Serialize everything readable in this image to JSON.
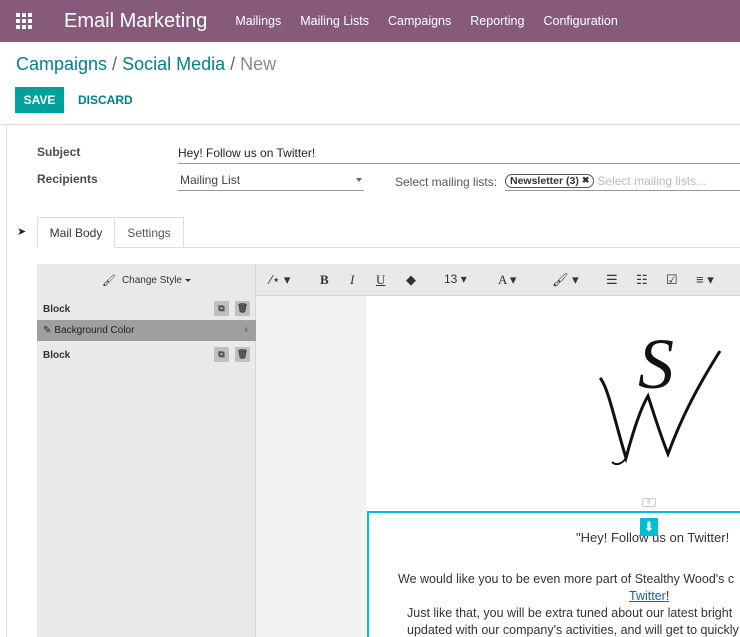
{
  "topbar": {
    "app_title": "Email Marketing",
    "menu": [
      "Mailings",
      "Mailing Lists",
      "Campaigns",
      "Reporting",
      "Configuration"
    ]
  },
  "breadcrumb": {
    "level1": "Campaigns",
    "level2": "Social Media",
    "current": "New",
    "separator": "/"
  },
  "actions": {
    "save": "SAVE",
    "discard": "DISCARD"
  },
  "form": {
    "subject_label": "Subject",
    "subject_value": "Hey! Follow us on Twitter!",
    "recipients_label": "Recipients",
    "recipients_value": "Mailing List",
    "mailing_lists_label": "Select mailing lists:",
    "mailing_list_tag": "Newsletter (3)",
    "mailing_list_placeholder": "Select mailing lists..."
  },
  "tabs": {
    "mail_body": "Mail Body",
    "settings": "Settings"
  },
  "editor": {
    "change_style": "Change Style",
    "block1": "Block",
    "background_color": "Background Color",
    "block2": "Block",
    "font_size": "13",
    "font_letter": "A"
  },
  "email": {
    "title": "\"Hey! Follow us on Twitter!",
    "p1": "We would like you to be even more part of Stealthy Wood's c",
    "link": "Twitter",
    "link_after": "!",
    "p2": "Just like that, you will be extra tuned about our latest bright",
    "p3": "updated with our company's activities, and will get to quickly"
  },
  "colors": {
    "brand": "#875a7b",
    "primary": "#00a09d",
    "link": "#00808a",
    "selection": "#00c0d6"
  }
}
